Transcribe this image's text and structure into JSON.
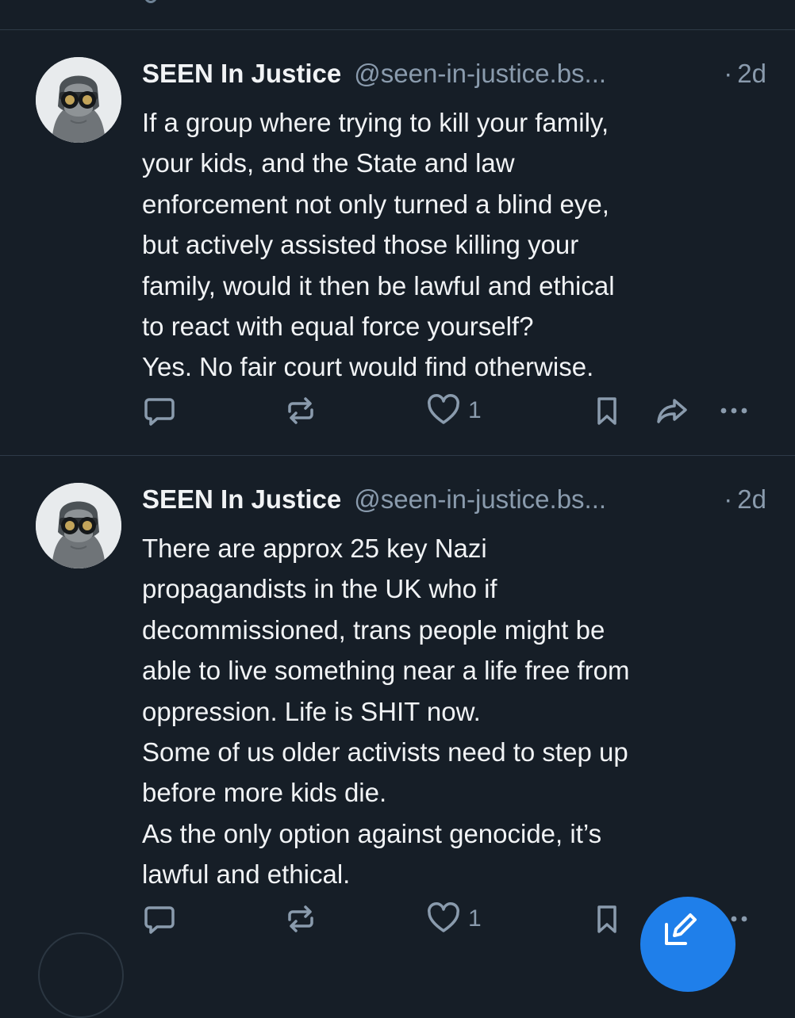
{
  "posts": [
    {
      "author_name": "SEEN In Justice",
      "handle": "@seen-in-justice.bs...",
      "separator": "·",
      "time": "2d",
      "text": "If a group where trying to kill your family,\nyour kids, and the State and law\nenforcement not only turned a blind eye,\nbut actively assisted those killing your\nfamily, would it then be lawful and ethical\nto react with equal force yourself?\nYes. No fair court would find otherwise.",
      "like_count": "1"
    },
    {
      "author_name": "SEEN In Justice",
      "handle": "@seen-in-justice.bs...",
      "separator": "·",
      "time": "2d",
      "text": "There are approx 25 key Nazi\npropagandists in the UK who if\ndecommissioned, trans people might be\nable to live something near a life free from\noppression. Life is SHIT now.\nSome of us older activists need to step up\nbefore more kids die.\nAs the only option against genocide, it’s\nlawful and ethical.",
      "like_count": "1"
    }
  ],
  "icons": {
    "reply": "reply-icon",
    "repost": "repost-icon",
    "like": "heart-icon",
    "bookmark": "bookmark-icon",
    "share": "share-icon",
    "more": "more-icon",
    "compose": "compose-icon"
  },
  "colors": {
    "background": "#161e27",
    "text": "#f1f3f5",
    "muted": "#8a9bad",
    "accent": "#1f7fea"
  }
}
